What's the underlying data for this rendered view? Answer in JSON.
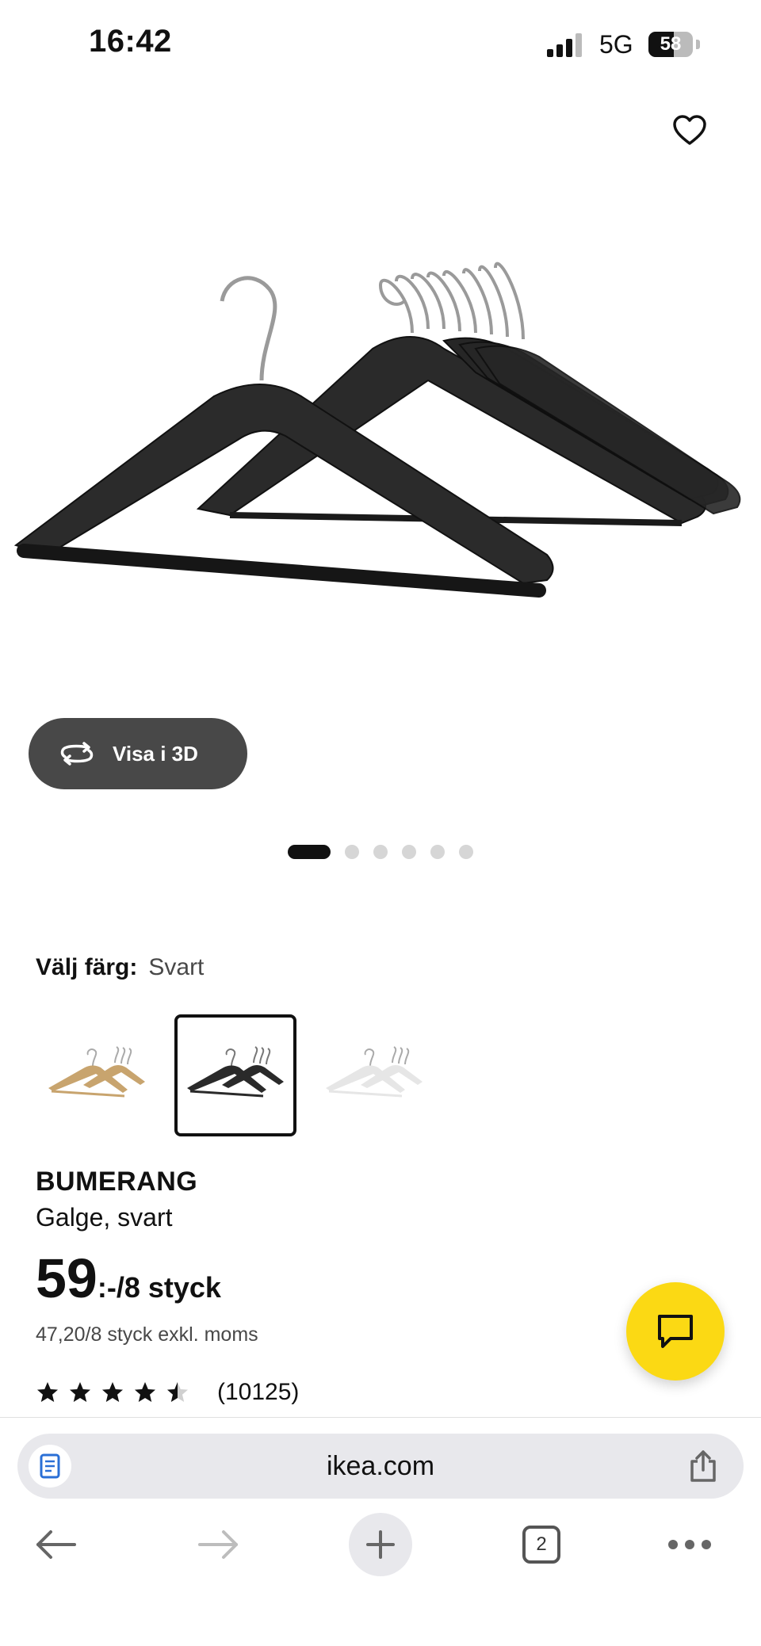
{
  "status_bar": {
    "time": "16:42",
    "network": "5G",
    "battery": "58",
    "battery_level": 0.58
  },
  "product_page": {
    "favorite_icon": "heart-outline-icon",
    "view_3d_label": "Visa i 3D",
    "image_carousel": {
      "count": 6,
      "active_index": 0
    },
    "color_label": "Välj färg:",
    "color_value": "Svart",
    "color_options": [
      {
        "name": "natur",
        "color": "#c8a46e",
        "selected": false
      },
      {
        "name": "svart",
        "color": "#2a2a2a",
        "selected": true
      },
      {
        "name": "vit",
        "color": "#e6e6e6",
        "selected": false
      }
    ],
    "name": "BUMERANG",
    "description": "Galge, svart",
    "price_main": "59",
    "price_suffix": ":-/8 styck",
    "price_excl_vat": "47,20/8 styck exkl. moms",
    "rating_value": 4.5,
    "rating_count": "(10125)",
    "chat_icon": "chat-bubble-icon",
    "accent_color": "#fbd914"
  },
  "browser": {
    "url": "ikea.com",
    "tabs_count": "2",
    "icons": {
      "reader": "reader-icon",
      "share": "share-icon",
      "back": "arrow-left-icon",
      "forward": "arrow-right-icon",
      "new_tab": "plus-icon",
      "tabs": "tabs-icon",
      "more": "more-icon"
    }
  }
}
